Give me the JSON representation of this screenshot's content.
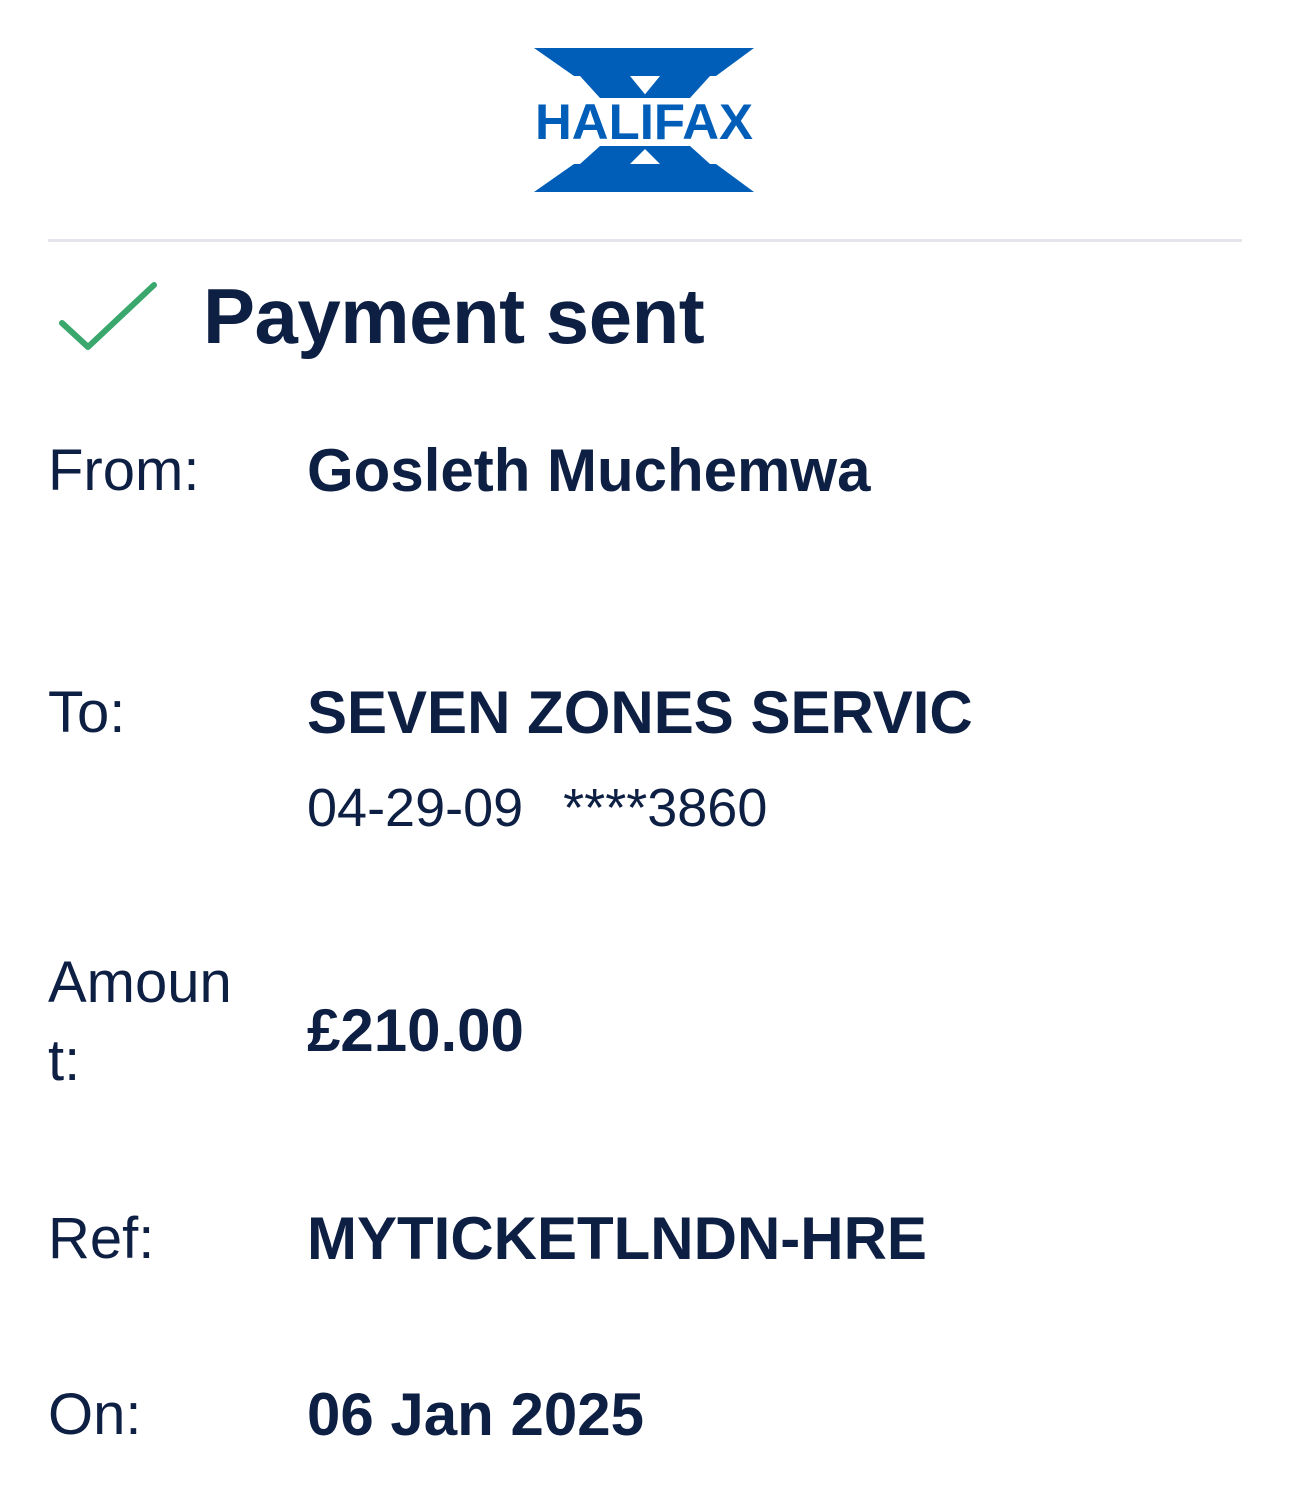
{
  "brand": {
    "name": "HALIFAX",
    "color": "#005eb8"
  },
  "status": {
    "icon": "check-icon",
    "title": "Payment sent",
    "icon_color": "#3aa76d"
  },
  "details": {
    "from": {
      "label": "From:",
      "value": "Gosleth Muchemwa"
    },
    "to": {
      "label": "To:",
      "value": "SEVEN ZONES SERVIC",
      "sort_code": "04-29-09",
      "account": "****3860"
    },
    "amount": {
      "label": "Amount:",
      "value": "£210.00"
    },
    "ref": {
      "label": "Ref:",
      "value": "MYTICKETLNDN-HRE"
    },
    "on": {
      "label": "On:",
      "value": "06 Jan 2025"
    }
  },
  "colors": {
    "text": "#0e1f44",
    "divider": "#e4e5ec"
  }
}
